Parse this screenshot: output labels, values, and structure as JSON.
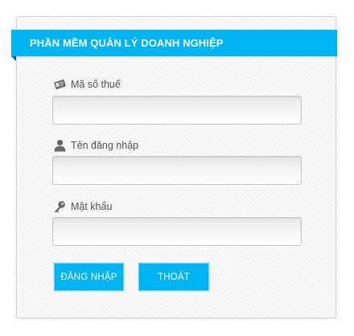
{
  "header": {
    "title": "PHẦN MỀM QUẢN LÝ DOANH NGHIỆP"
  },
  "form": {
    "tax_code": {
      "label": "Mã số thuế",
      "icon": "id-card-icon",
      "value": "",
      "placeholder": ""
    },
    "username": {
      "label": "Tên đăng nhập",
      "icon": "user-icon",
      "value": "",
      "placeholder": ""
    },
    "password": {
      "label": "Mật khẩu",
      "icon": "key-icon",
      "value": "",
      "placeholder": ""
    }
  },
  "buttons": {
    "login_label": "ĐĂNG NHẬP",
    "exit_label": "THOÁT"
  },
  "colors": {
    "accent": "#00b4f1",
    "accent_dark": "#00638a",
    "label_text": "#555555",
    "button_text": "#ffffff"
  }
}
